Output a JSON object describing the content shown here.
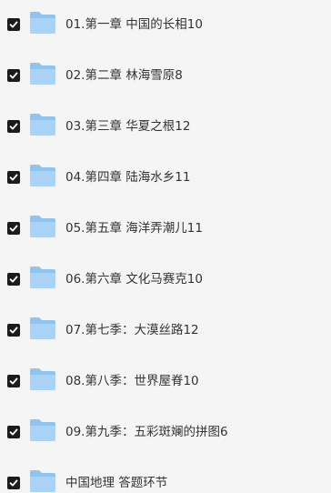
{
  "colors": {
    "background": "#f5f5f6",
    "checkbox": "#1b1b1b",
    "folder_light": "#a9d3f7",
    "folder_mid": "#8ec4f2",
    "text": "#333333"
  },
  "items": [
    {
      "label": "01.第一章 中国的长相10",
      "checked": true,
      "icon": "folder-icon"
    },
    {
      "label": "02.第二章 林海雪原8",
      "checked": true,
      "icon": "folder-icon"
    },
    {
      "label": "03.第三章 华夏之根12",
      "checked": true,
      "icon": "folder-icon"
    },
    {
      "label": "04.第四章 陆海水乡11",
      "checked": true,
      "icon": "folder-icon"
    },
    {
      "label": "05.第五章 海洋弄潮儿11",
      "checked": true,
      "icon": "folder-icon"
    },
    {
      "label": "06.第六章 文化马赛克10",
      "checked": true,
      "icon": "folder-icon"
    },
    {
      "label": "07.第七季：大漠丝路12",
      "checked": true,
      "icon": "folder-icon"
    },
    {
      "label": "08.第八季：世界屋脊10",
      "checked": true,
      "icon": "folder-icon"
    },
    {
      "label": "09.第九季：五彩斑斓的拼图6",
      "checked": true,
      "icon": "folder-icon"
    },
    {
      "label": "中国地理 答题环节",
      "checked": true,
      "icon": "folder-icon"
    }
  ]
}
